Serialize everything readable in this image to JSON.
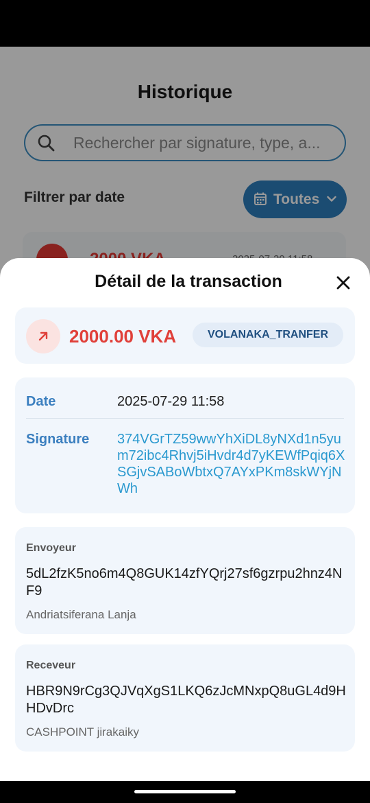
{
  "page": {
    "title": "Historique",
    "search": {
      "placeholder": "Rechercher par signature, type, a..."
    },
    "filter": {
      "label": "Filtrer par date",
      "button_label": "Toutes"
    },
    "history_preview": {
      "amount": "2000 VKA",
      "date": "2025-07-29 11:58"
    }
  },
  "detail": {
    "title": "Détail de la transaction",
    "amount": "2000.00 VKA",
    "type": "VOLANAKA_TRANFER",
    "date_label": "Date",
    "date_value": "2025-07-29 11:58",
    "signature_label": "Signature",
    "signature_value": "374VGrTZ59wwYhXiDL8yNXd1n5yum72ibc4Rhvj5iHvdr4d7yKEWfPqiq6XSGjvSABoWbtxQ7AYxPKm8skWYjNWh",
    "sender": {
      "title": "Envoyeur",
      "address": "5dL2fzK5no6m4Q8GUK14zfYQrj27sf6gzrpu2hnz4NF9",
      "name": "Andriatsiferana Lanja"
    },
    "receiver": {
      "title": "Receveur",
      "address": "HBR9N9rCg3QJVqXgS1LKQ6zJcMNxpQ8uGL4d9HHDvDrc",
      "name": "CASHPOINT jirakaiky"
    }
  },
  "colors": {
    "accent": "#2d7fbf",
    "debit": "#e0403a",
    "link": "#2a99cf",
    "card_bg": "#f1f6fc"
  },
  "icons": [
    "search-icon",
    "calendar-icon",
    "chevron-down-icon",
    "close-icon",
    "arrow-up-right-icon"
  ]
}
